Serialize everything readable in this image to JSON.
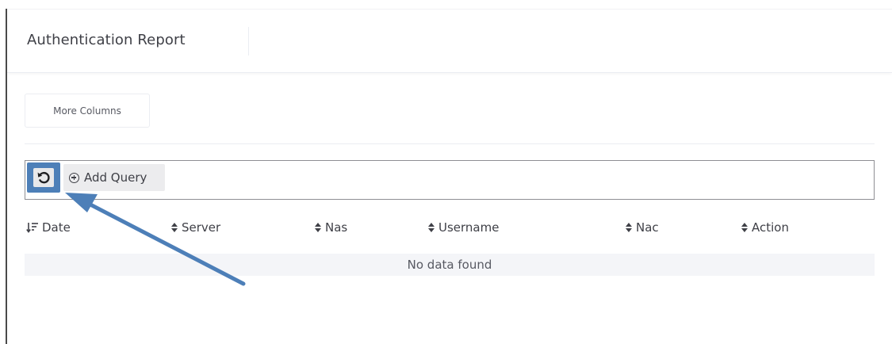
{
  "header": {
    "title": "Authentication Report"
  },
  "toolbar": {
    "more_columns_label": "More Columns"
  },
  "query": {
    "reset_icon": "reset-icon",
    "add_query_icon": "plus-circle-icon",
    "add_query_label": "Add Query"
  },
  "table": {
    "columns": [
      {
        "label": "Date",
        "sort_icon": "sort-desc-icon"
      },
      {
        "label": "Server",
        "sort_icon": "sort-icon"
      },
      {
        "label": "Nas",
        "sort_icon": "sort-icon"
      },
      {
        "label": "Username",
        "sort_icon": "sort-icon"
      },
      {
        "label": "Nac",
        "sort_icon": "sort-icon"
      },
      {
        "label": "Action",
        "sort_icon": "sort-icon"
      }
    ],
    "empty_message": "No data found"
  },
  "colors": {
    "highlight": "#4d7fb8",
    "text": "#3f4047",
    "border": "#ebedf2"
  }
}
